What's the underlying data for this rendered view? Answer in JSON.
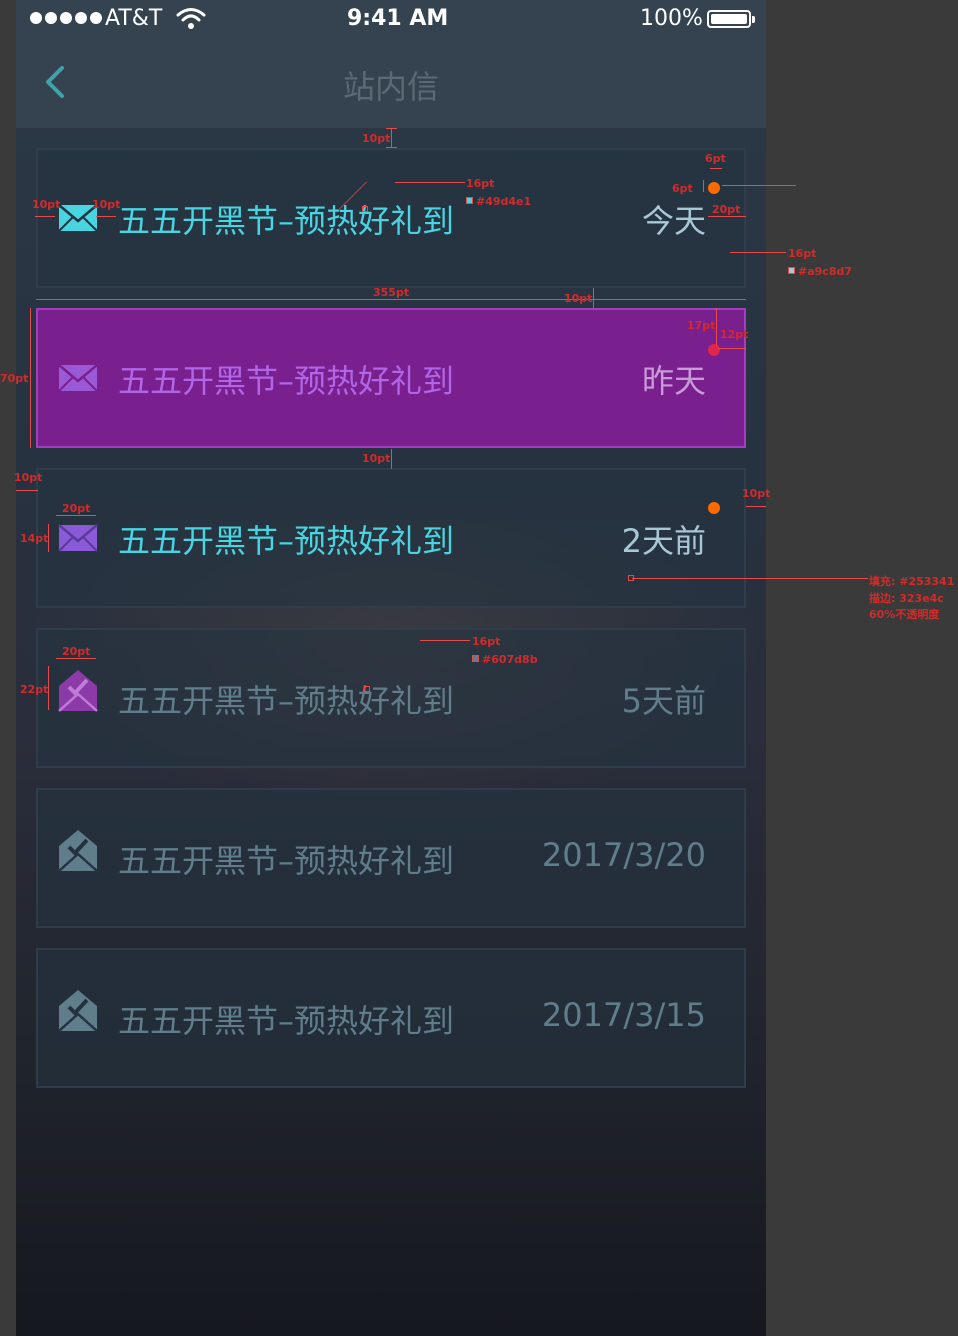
{
  "status_bar": {
    "carrier": "AT&T",
    "time": "9:41 AM",
    "battery": "100%",
    "battery_level": 1.0,
    "signal_bars": 5
  },
  "nav": {
    "back_icon": "chevron-left-icon",
    "title": "站内信"
  },
  "messages": [
    {
      "title": "五五开黑节–预热好礼到",
      "date": "今天",
      "state": "unread",
      "icon": "envelope-icon",
      "badge": true
    },
    {
      "title": "五五开黑节–预热好礼到",
      "date": "昨天",
      "state": "selected",
      "icon": "envelope-icon",
      "badge": true
    },
    {
      "title": "五五开黑节–预热好礼到",
      "date": "2天前",
      "state": "unread",
      "icon": "envelope-icon",
      "badge": true
    },
    {
      "title": "五五开黑节–预热好礼到",
      "date": "5天前",
      "state": "read-gift",
      "icon": "open-envelope-icon",
      "badge": false
    },
    {
      "title": "五五开黑节–预热好礼到",
      "date": "2017/3/20",
      "state": "read",
      "icon": "open-envelope-icon",
      "badge": false
    },
    {
      "title": "五五开黑节–预热好礼到",
      "date": "2017/3/15",
      "state": "read",
      "icon": "open-envelope-icon",
      "badge": false
    }
  ],
  "colors": {
    "unread_title": "#49d4e1",
    "date_text": "#a9c8d7",
    "read_text": "#607d8b",
    "card_fill": "#253341",
    "card_stroke": "#323e4c",
    "badge": "#ff6a00",
    "selected_bg": "#7a1f8e"
  },
  "annotations": {
    "spacing_10": "10pt",
    "title_size": "16pt",
    "title_color": "#49d4e1",
    "badge_size": "6pt",
    "badge_offset": "6pt",
    "date_right": "20pt",
    "date_size": "16pt",
    "date_color": "#a9c8d7",
    "card_width": "355pt",
    "badge_top": "17pt",
    "badge_right": "12pt",
    "card_height": "70pt",
    "icon_width": "20pt",
    "icon_height_mail": "14pt",
    "icon_height_gift": "22pt",
    "read_size": "16pt",
    "read_color": "#607d8b",
    "fill_note": "填充: #253341",
    "stroke_note": "描边: 323e4c",
    "opacity_note": "60%不透明度"
  }
}
